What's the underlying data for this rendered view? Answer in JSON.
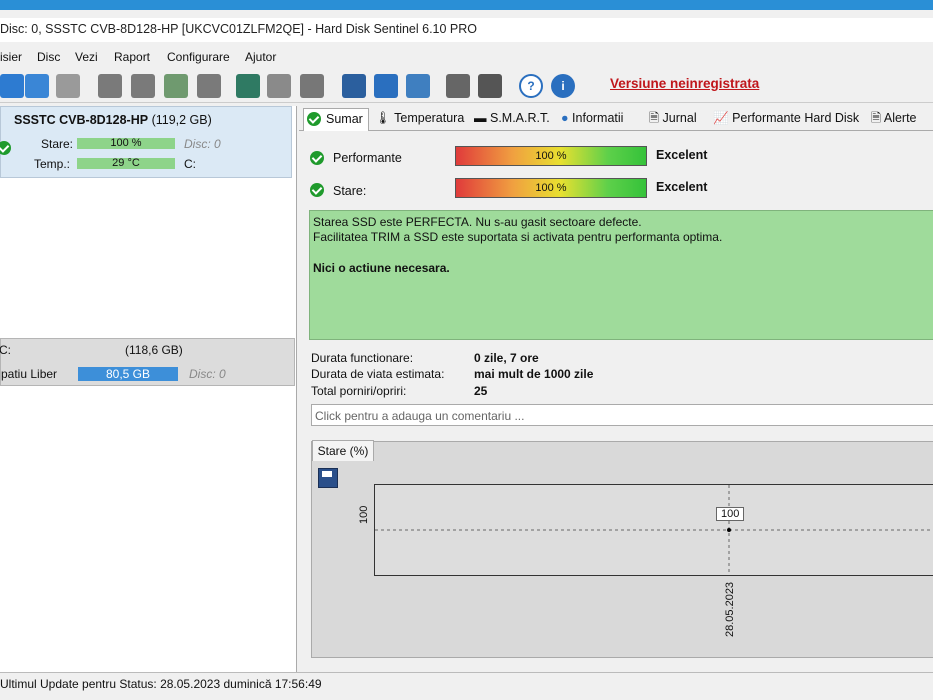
{
  "window": {
    "title": "Disc: 0, SSSTC CVB-8D128-HP [UKCVC01ZLFM2QE]  -  Hard Disk Sentinel 6.10 PRO"
  },
  "menu": [
    "isier",
    "Disc",
    "Vezi",
    "Raport",
    "Configurare",
    "Ajutor"
  ],
  "toolbar": {
    "unregistered_label": "Versiune neinregistrata",
    "icons": [
      "refresh-icon",
      "sync-warning-icon",
      "list-icon",
      "disk-icon",
      "disk-clock-icon",
      "disk-check-icon",
      "disk-search-icon",
      "web-globe-icon",
      "backup-icon",
      "drive-export-icon",
      "report-icon",
      "mail-icon",
      "network-icon",
      "settings-gear-icon",
      "speaker-icon",
      "help-icon",
      "info-icon"
    ],
    "colors": {
      "unregistered": "#c0161b"
    }
  },
  "disk": {
    "name": "SSSTC CVB-8D128-HP",
    "size": "(119,2 GB)",
    "stare_label": "Stare:",
    "stare_value": "100 %",
    "temp_label": "Temp.:",
    "temp_value": "29 °C",
    "disc_label": "Disc: 0",
    "drive_letter": "C:"
  },
  "partition": {
    "letter": "C:",
    "size": "(118,6 GB)",
    "free_label": "patiu Liber",
    "free_value": "80,5 GB",
    "disc_label": "Disc: 0"
  },
  "tabs": [
    "Sumar",
    "Temperatura",
    "S.M.A.R.T.",
    "Informatii",
    "Jurnal",
    "Performante Hard Disk",
    "Alerte"
  ],
  "summary": {
    "performance_label": "Performante",
    "performance_value": "100 %",
    "performance_grade": "Excelent",
    "health_label": "Stare:",
    "health_value": "100 %",
    "health_grade": "Excelent",
    "status_lines": [
      "Starea SSD este PERFECTA. Nu s-au gasit sectoare defecte.",
      "Facilitatea TRIM a SSD este suportata si activata pentru performanta optima."
    ],
    "action": "Nici o actiune necesara.",
    "status_color": "#9fdb9b"
  },
  "info": {
    "uptime_label": "Durata functionare:",
    "uptime_value": "0 zile, 7 ore",
    "lifetime_label": "Durata de viata estimata:",
    "lifetime_value": "mai mult de 1000 zile",
    "powercycles_label": "Total porniri/opriri:",
    "powercycles_value": "25",
    "comment_placeholder": "Click pentru a adauga un comentariu ..."
  },
  "graph": {
    "tab_label": "Stare (%)"
  },
  "chart_data": {
    "type": "line",
    "x": [
      "28.05.2023"
    ],
    "series": [
      {
        "values": [
          100
        ]
      }
    ],
    "ytick": "100",
    "xtick": "28.05.2023",
    "point_label": "100"
  },
  "statusbar": {
    "text": "Ultimul Update pentru Status: 28.05.2023 duminică 17:56:49"
  }
}
